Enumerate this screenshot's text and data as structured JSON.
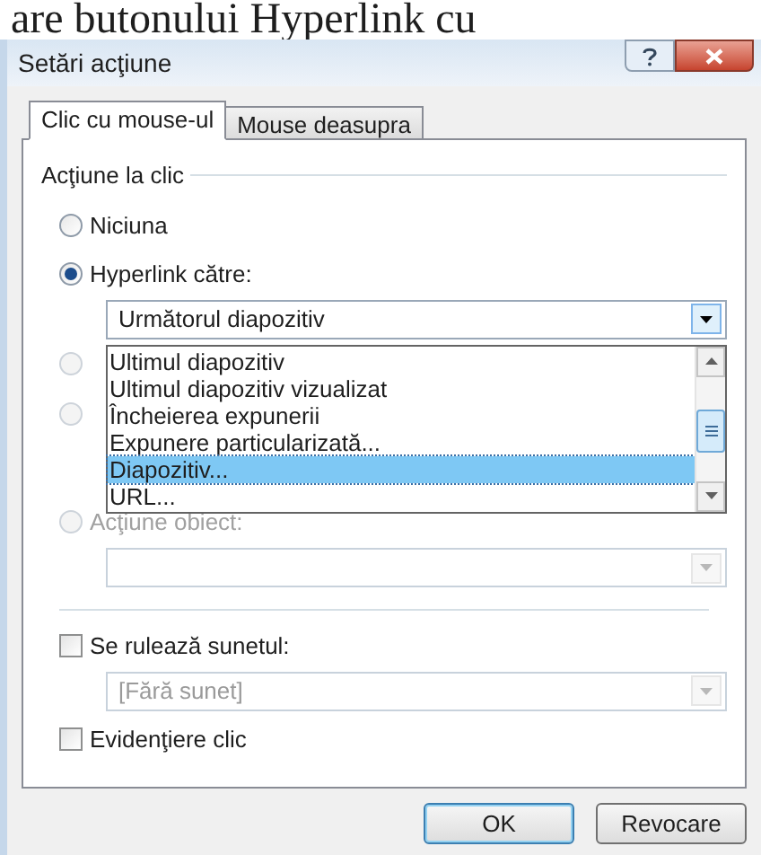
{
  "background_text": "are butonului Hyperlink cu",
  "window": {
    "title": "Setări acţiune"
  },
  "tabs": [
    {
      "label": "Clic cu mouse-ul",
      "selected": true
    },
    {
      "label": "Mouse deasupra",
      "selected": false
    }
  ],
  "group": {
    "title": "Acţiune la clic"
  },
  "options": [
    {
      "label": "Niciuna",
      "selected": false
    },
    {
      "label": "Hyperlink către:",
      "selected": true
    }
  ],
  "hyperlink_field": {
    "value": "Următorul diapozitiv"
  },
  "dropdown_list": [
    {
      "label": "Ultimul diapozitiv",
      "selected": false
    },
    {
      "label": "Ultimul diapozitiv vizualizat",
      "selected": false
    },
    {
      "label": "Încheierea expunerii",
      "selected": false
    },
    {
      "label": "Expunere particularizată...",
      "selected": false
    },
    {
      "label": "Diapozitiv...",
      "selected": true
    },
    {
      "label": "URL...",
      "selected": false
    }
  ],
  "covered_options": [
    {
      "selected": false
    },
    {
      "selected": false
    }
  ],
  "object_action": {
    "label": "Acţiune obiect:",
    "selected": false,
    "disabled": true
  },
  "sound": {
    "label": "Se rulează sunetul:",
    "checked": false,
    "value": "[Fără sunet]",
    "disabled": true
  },
  "highlight": {
    "label": "Evidenţiere clic",
    "checked": false
  },
  "buttons": [
    {
      "label": "OK",
      "default": true
    },
    {
      "label": "Revocare",
      "default": false
    }
  ]
}
